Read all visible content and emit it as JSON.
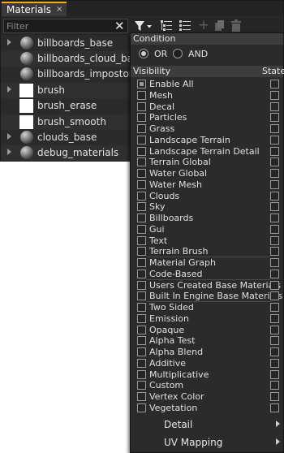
{
  "tab": {
    "title": "Materials",
    "close": "×"
  },
  "filter": {
    "placeholder": "Filter",
    "value": "",
    "clear": "✕"
  },
  "toolbar_icons": [
    "filter-icon",
    "expand-all-icon",
    "collapse-all-icon",
    "add-icon",
    "copy-icon",
    "delete-icon"
  ],
  "materials": [
    {
      "name": "billboards_base",
      "icon": "sphere",
      "expandable": true
    },
    {
      "name": "billboards_cloud_base",
      "icon": "sphere",
      "expandable": false
    },
    {
      "name": "billboards_impostor_base",
      "icon": "sphere",
      "expandable": false
    },
    {
      "name": "brush",
      "icon": "white-square",
      "expandable": true
    },
    {
      "name": "brush_erase",
      "icon": "white-square",
      "expandable": false
    },
    {
      "name": "brush_smooth",
      "icon": "white-square",
      "expandable": false
    },
    {
      "name": "clouds_base",
      "icon": "sphere",
      "expandable": true
    },
    {
      "name": "debug_materials",
      "icon": "sphere",
      "expandable": true
    }
  ],
  "dropdown": {
    "condition_title": "Condition",
    "or_label": "OR",
    "and_label": "AND",
    "selected_condition": "OR",
    "visibility_title": "Visibility",
    "state_title": "State",
    "enable_all": "Enable All",
    "group1": [
      "Mesh",
      "Decal",
      "Particles",
      "Grass",
      "Landscape Terrain",
      "Landscape Terrain Detail",
      "Terrain Global",
      "Water Global",
      "Water Mesh",
      "Clouds",
      "Sky",
      "Billboards",
      "Gui",
      "Text",
      "Terrain Brush"
    ],
    "group2": [
      "Material Graph",
      "Code-Based"
    ],
    "group3": [
      "Users Created Base Materials",
      "Built In Engine Base Materials"
    ],
    "group4": [
      "Two Sided",
      "Emission",
      "Opaque",
      "Alpha Test",
      "Alpha Blend",
      "Additive",
      "Multiplicative",
      "Custom",
      "Vertex Color",
      "Vegetation"
    ],
    "submenus": [
      "Detail",
      "UV Mapping"
    ]
  },
  "colors": {
    "accent": "#f5a623",
    "panel_bg": "#2b2b2b",
    "header_bg": "#3d3d3d"
  }
}
